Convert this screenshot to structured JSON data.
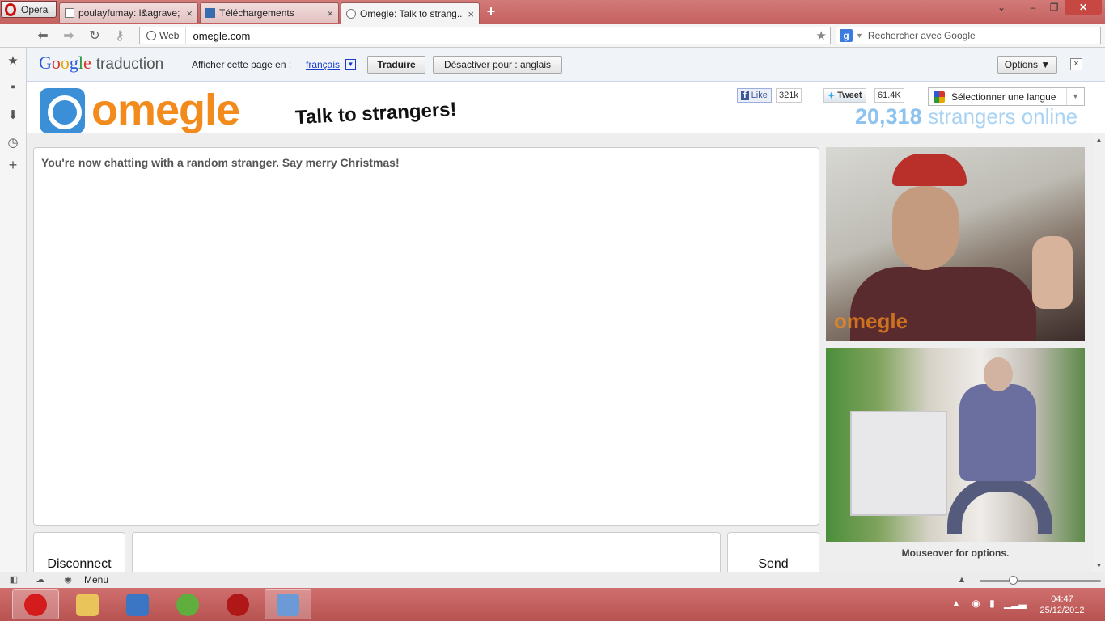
{
  "browser": {
    "menu_label": "Opera",
    "tabs": [
      {
        "title": "poulayfumay: l&agrave;",
        "close": "×"
      },
      {
        "title": "Téléchargements",
        "close": "×"
      },
      {
        "title": "Omegle: Talk to strang...",
        "close": "×"
      }
    ],
    "new_tab": "+",
    "address": {
      "badge": "Web",
      "url": "omegle.com"
    },
    "search_placeholder": "Rechercher avec Google"
  },
  "translate_bar": {
    "logo_google": "Google",
    "logo_product": "traduction",
    "prompt": "Afficher cette page en :",
    "language": "français",
    "translate_button": "Traduire",
    "disable_button": "Désactiver pour : anglais",
    "options_button": "Options ▼",
    "close": "×"
  },
  "omegle": {
    "logo_text": "omegle",
    "tagline": "Talk to strangers!",
    "facebook": {
      "label": "Like",
      "count": "321k"
    },
    "twitter": {
      "label": "Tweet",
      "count": "61.4K"
    },
    "language_select": "Sélectionner une langue",
    "online_count": "20,318",
    "online_label": "strangers online",
    "chat_status": "You're now chatting with a random stranger. Say merry Christmas!",
    "disconnect_button": "Disconnect",
    "send_button": "Send",
    "video_watermark": "omegle",
    "video_caption": "Mouseover for options."
  },
  "statusbar": {
    "menu_label": "Menu"
  },
  "taskbar": {
    "clock_time": "04:47",
    "clock_date": "25/12/2012"
  },
  "colors": {
    "omegle_orange": "#f38a1c",
    "omegle_blue": "#3a8fd7",
    "taskbar": "#c0605e"
  }
}
